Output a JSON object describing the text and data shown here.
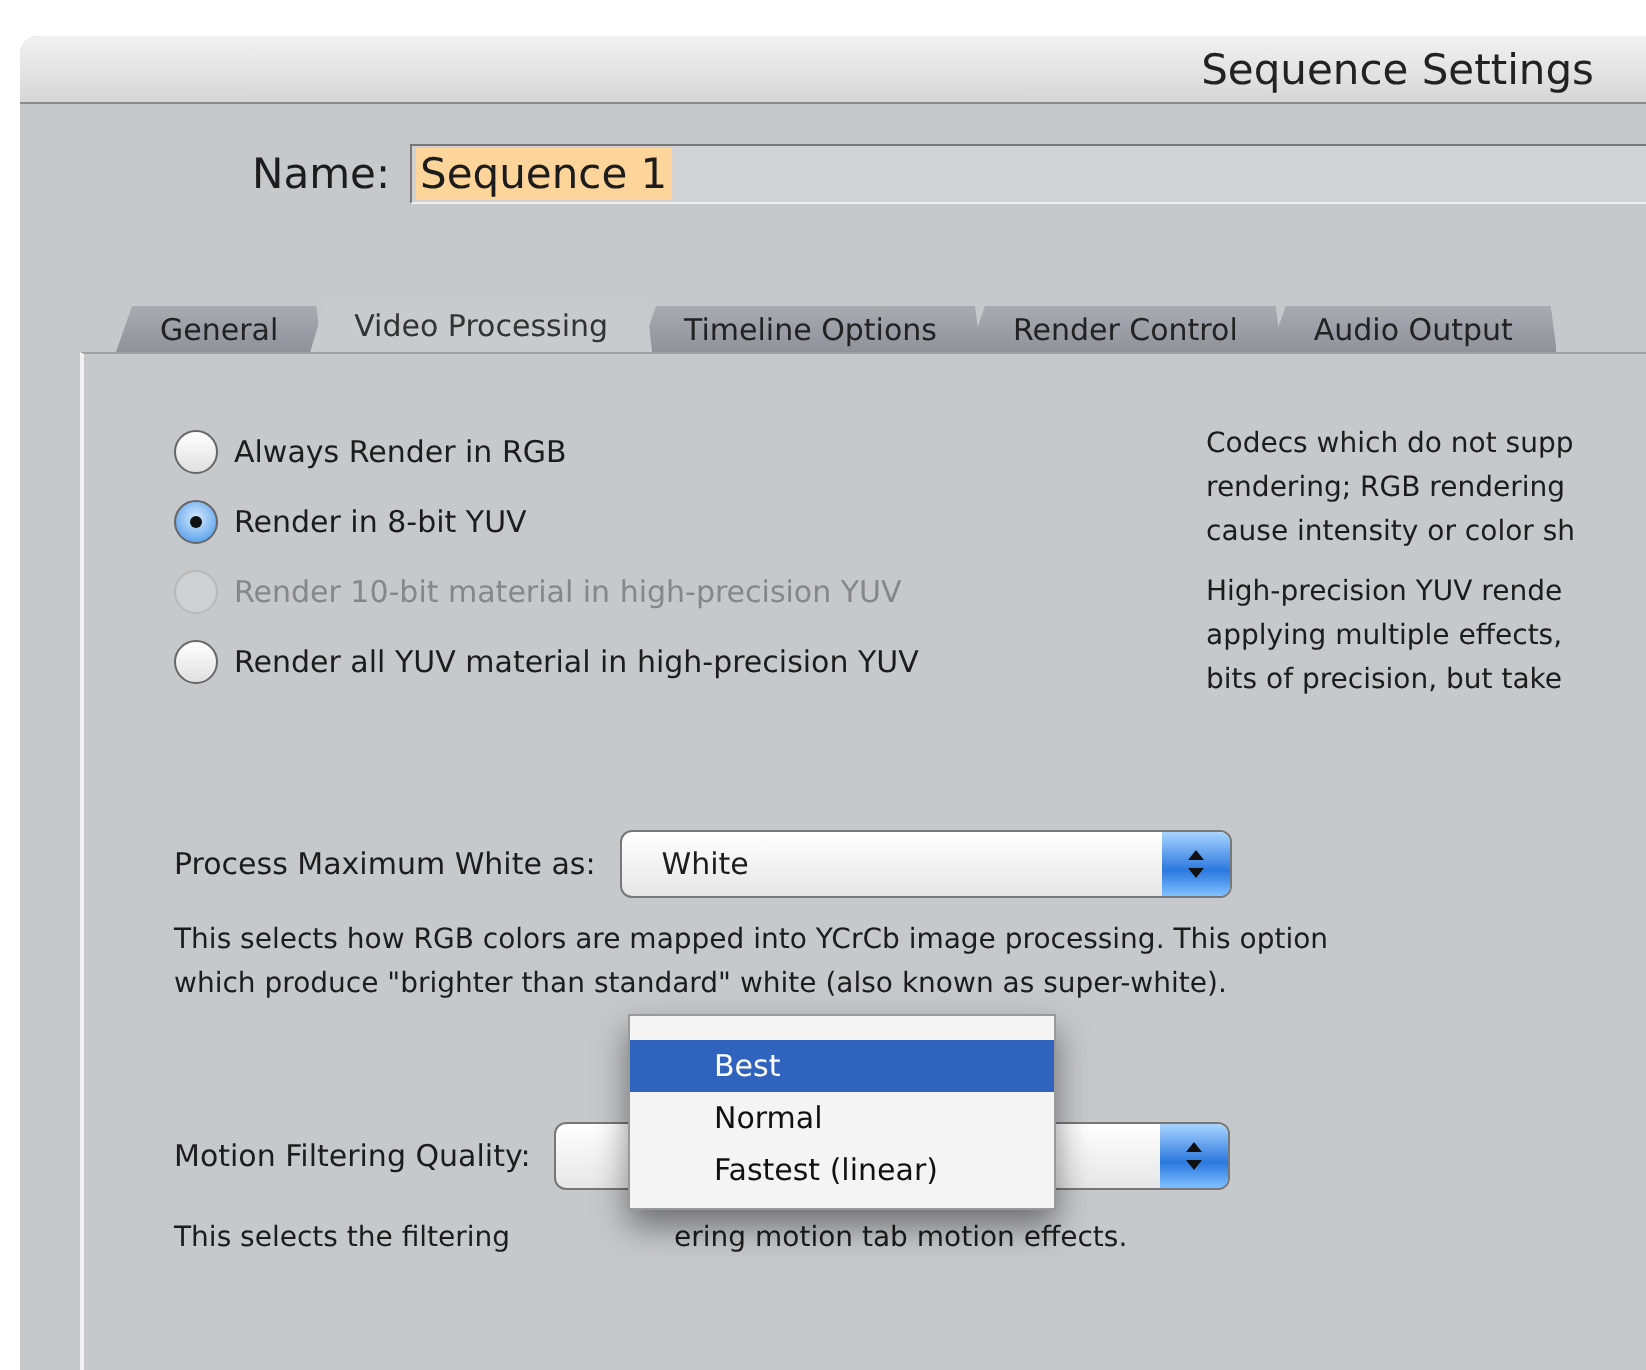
{
  "window": {
    "title": "Sequence Settings"
  },
  "name_field": {
    "label": "Name:",
    "value": "Sequence 1"
  },
  "tabs": [
    {
      "label": "General",
      "selected": false
    },
    {
      "label": "Video Processing",
      "selected": true
    },
    {
      "label": "Timeline Options",
      "selected": false
    },
    {
      "label": "Render Control",
      "selected": false
    },
    {
      "label": "Audio Output",
      "selected": false
    }
  ],
  "render_options": [
    {
      "label": "Always Render in RGB",
      "selected": false,
      "disabled": false
    },
    {
      "label": "Render in 8-bit YUV",
      "selected": true,
      "disabled": false
    },
    {
      "label": "Render 10-bit material in high-precision YUV",
      "selected": false,
      "disabled": true
    },
    {
      "label": "Render all YUV material in high-precision YUV",
      "selected": false,
      "disabled": false
    }
  ],
  "info_paragraphs": [
    [
      "Codecs which do not supp",
      "rendering; RGB rendering",
      "cause intensity or color sh"
    ],
    [
      "High-precision YUV rende",
      "applying multiple effects,",
      "bits of precision, but take"
    ]
  ],
  "max_white": {
    "label": "Process Maximum White as:",
    "value": "White",
    "description": [
      "This selects how RGB colors are mapped into YCrCb image processing. This option",
      "which produce \"brighter than standard\" white (also known as super-white)."
    ]
  },
  "motion_filtering": {
    "label": "Motion Filtering Quality:",
    "open": true,
    "menu": [
      {
        "label": "Best",
        "selected": true
      },
      {
        "label": "Normal",
        "selected": false
      },
      {
        "label": "Fastest (linear)",
        "selected": false
      }
    ],
    "description": [
      "This selects the filtering",
      "ering motion tab motion effects."
    ]
  }
}
